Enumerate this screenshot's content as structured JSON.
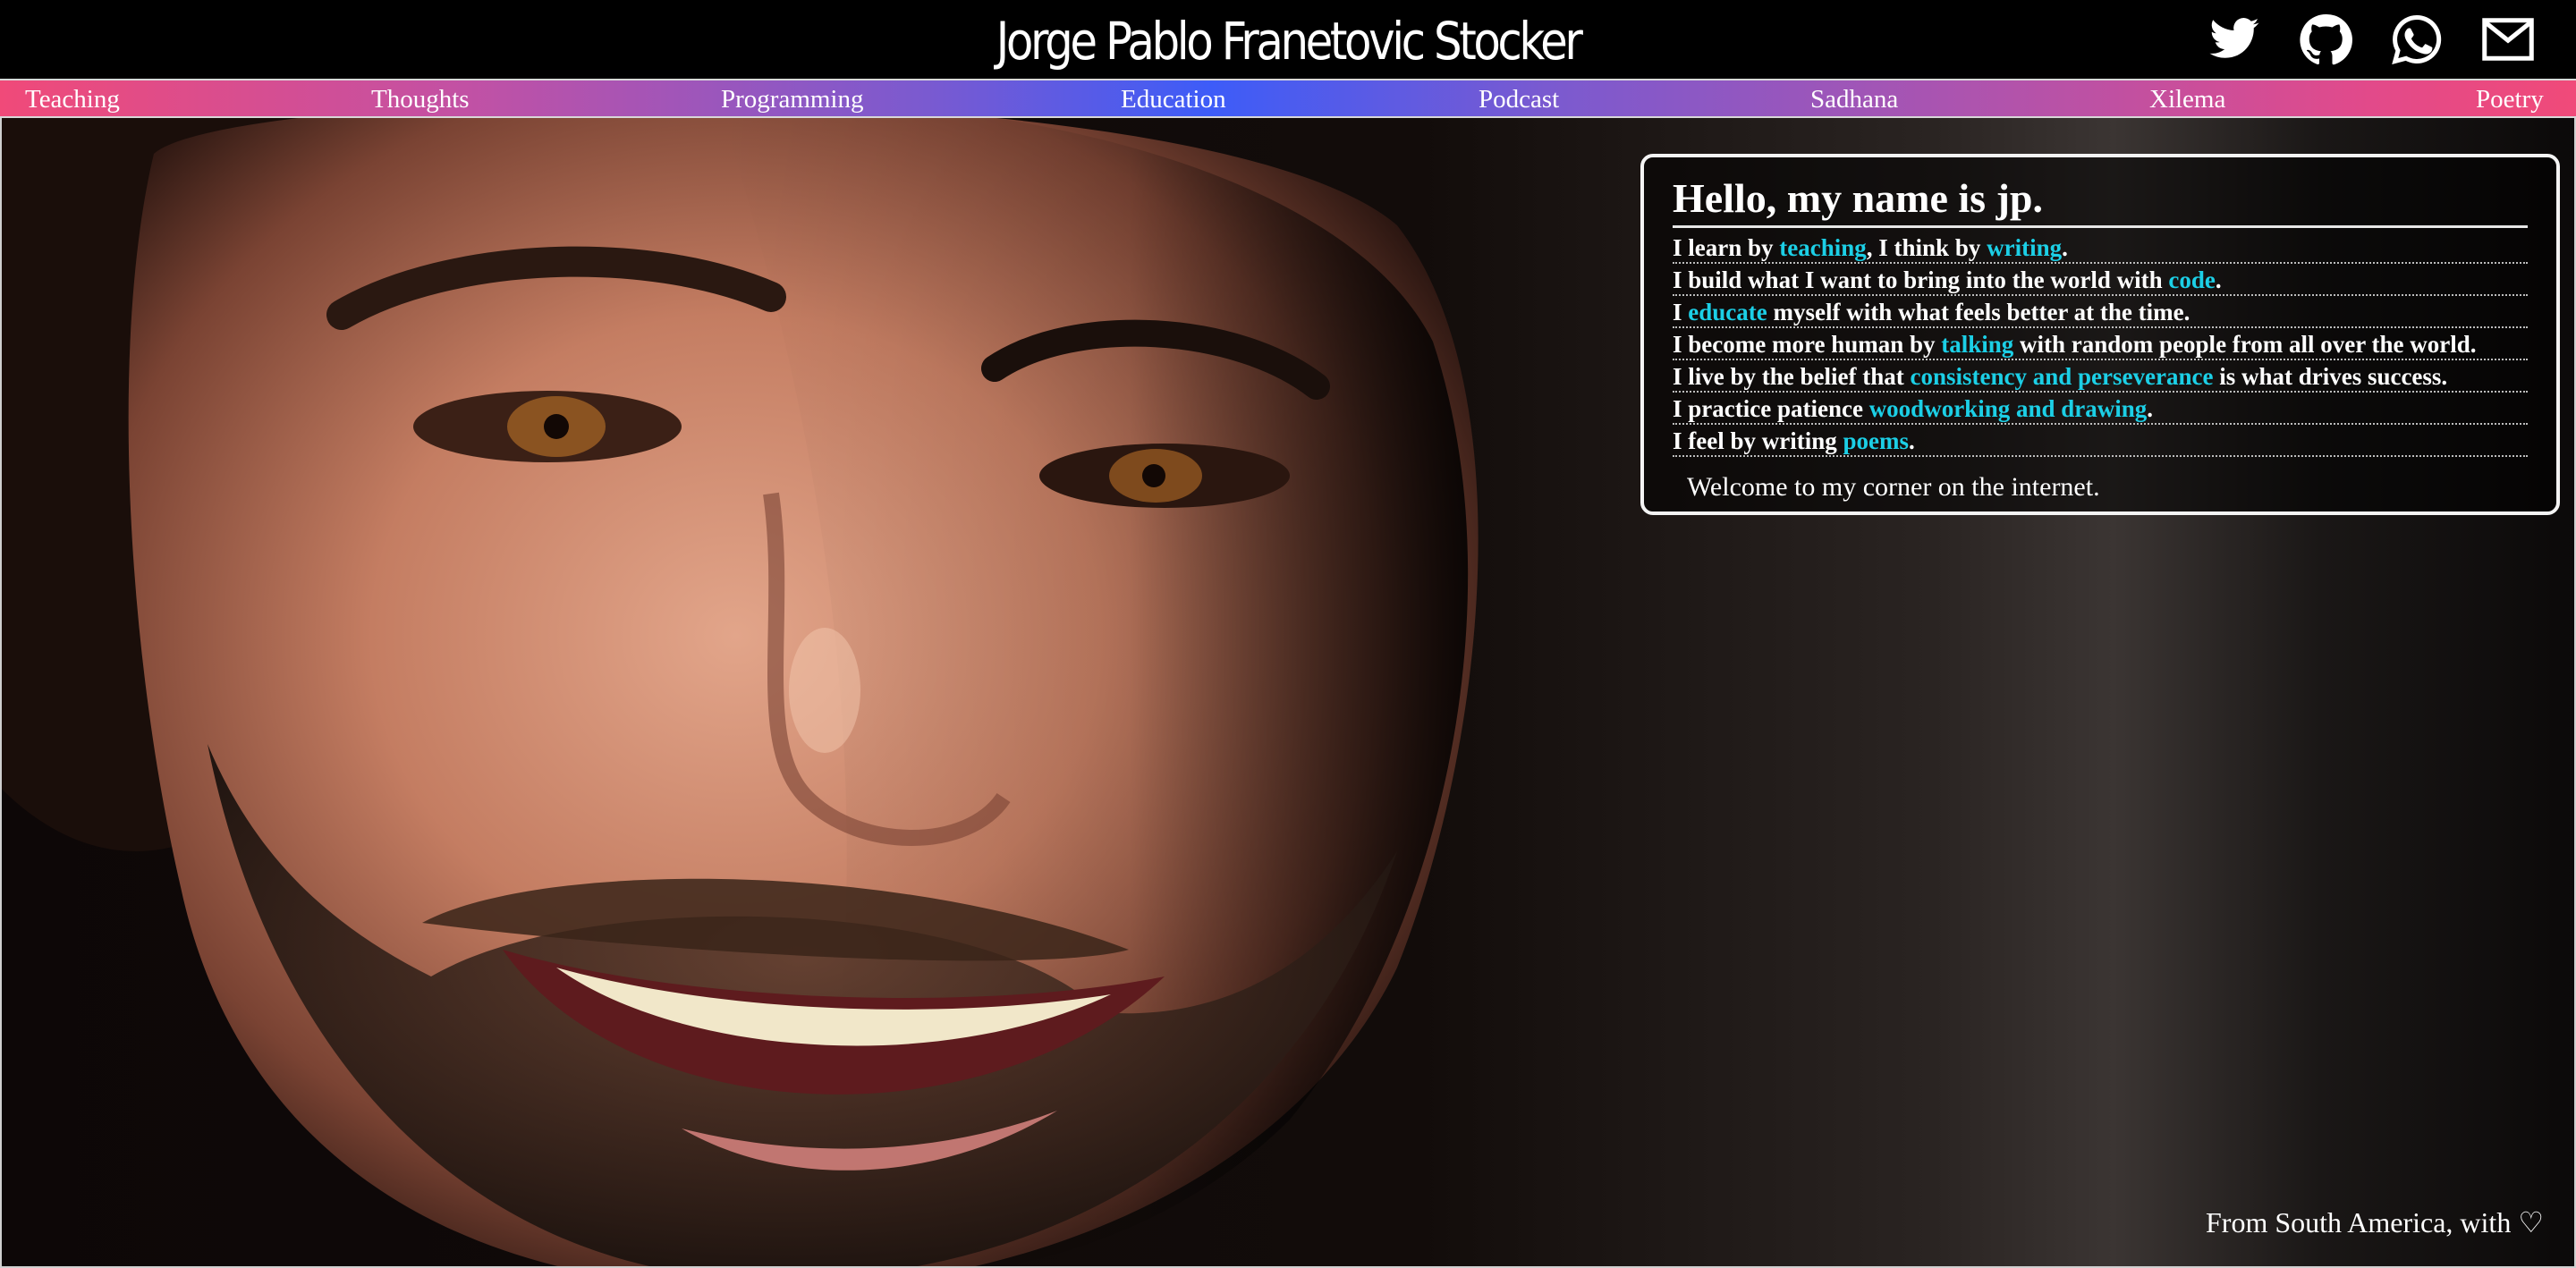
{
  "header": {
    "title": "Jorge Pablo Franetovic Stocker",
    "social": [
      {
        "name": "twitter-icon"
      },
      {
        "name": "github-icon"
      },
      {
        "name": "whatsapp-icon"
      },
      {
        "name": "mail-icon"
      }
    ]
  },
  "nav": {
    "items": [
      {
        "label": "Teaching"
      },
      {
        "label": "Thoughts"
      },
      {
        "label": "Programming"
      },
      {
        "label": "Education"
      },
      {
        "label": "Podcast"
      },
      {
        "label": "Sadhana"
      },
      {
        "label": "Xilema"
      },
      {
        "label": "Poetry"
      }
    ]
  },
  "card": {
    "heading": "Hello, my name is jp.",
    "lines": [
      {
        "p": [
          "I learn by ",
          "teaching",
          ", I think by ",
          "writing",
          "."
        ]
      },
      {
        "p": [
          "I build what I want to bring into the world with ",
          "code",
          "."
        ]
      },
      {
        "p": [
          "I ",
          "educate",
          " myself with what feels better at the time."
        ]
      },
      {
        "p": [
          "I become more human by ",
          "talking",
          " with random people from all over the world."
        ]
      },
      {
        "p": [
          "I live by the belief that ",
          "consistency and perseverance",
          " is what drives success."
        ]
      },
      {
        "p": [
          "I practice patience ",
          "woodworking and drawing",
          "."
        ]
      },
      {
        "p": [
          "I feel by writing ",
          "poems",
          "."
        ]
      }
    ],
    "welcome": "Welcome to my corner on the internet."
  },
  "footer": {
    "note": "From South America, with ♡"
  },
  "colors": {
    "highlight": "#1ccfe6",
    "nav_gradient_start": "#f04a79",
    "nav_gradient_mid": "#3d5cf8"
  }
}
